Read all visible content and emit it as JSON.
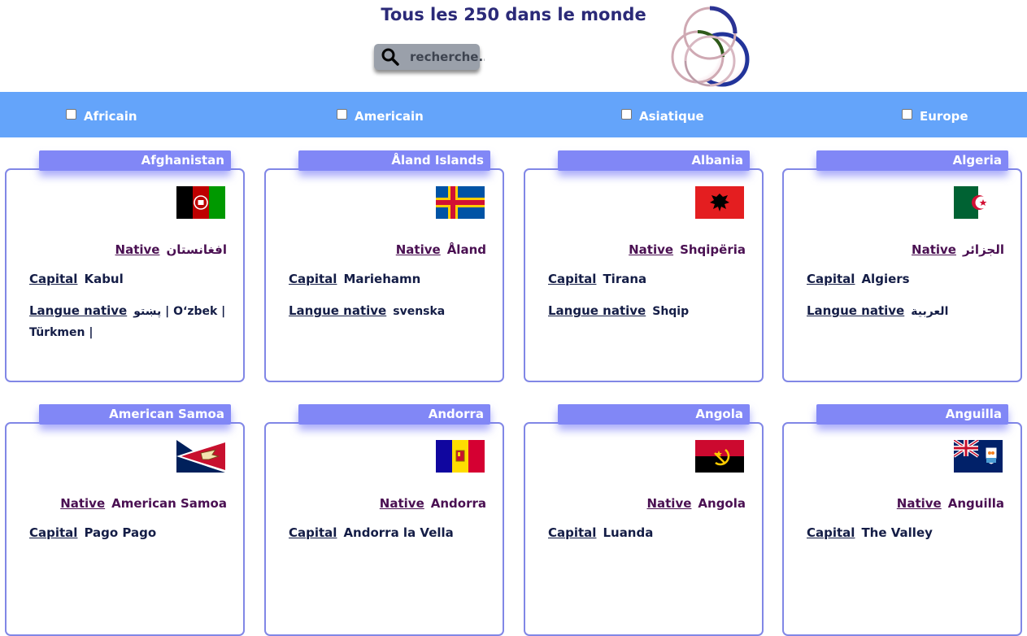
{
  "header": {
    "title": "Tous les 250 dans le monde",
    "search_placeholder": "recherche..",
    "icons": {
      "search": "search-icon",
      "logo": "interlocking-rings-logo"
    }
  },
  "colors": {
    "title": "#2b2a78",
    "filter_bar": "#64a4fa",
    "card_header": "#8187f6",
    "native_text": "#4a1052",
    "body_text": "#141d46"
  },
  "filters": [
    {
      "label": "Africain",
      "checked": false
    },
    {
      "label": "Americain",
      "checked": false
    },
    {
      "label": "Asiatique",
      "checked": false
    },
    {
      "label": "Europe",
      "checked": false
    }
  ],
  "labels": {
    "native": "Native",
    "capital": "Capital",
    "language": "Langue native"
  },
  "countries": [
    {
      "name": "Afghanistan",
      "flag": "afghanistan-flag-icon",
      "native": "افغانستان",
      "capital": "Kabul",
      "languages": "پښتو | Oʻzbek | Türkmen |"
    },
    {
      "name": "Åland Islands",
      "flag": "aland-flag-icon",
      "native": "Åland",
      "capital": "Mariehamn",
      "languages": "svenska"
    },
    {
      "name": "Albania",
      "flag": "albania-flag-icon",
      "native": "Shqipëria",
      "capital": "Tirana",
      "languages": "Shqip"
    },
    {
      "name": "Algeria",
      "flag": "algeria-flag-icon",
      "native": "الجزائر",
      "capital": "Algiers",
      "languages": "العربية"
    },
    {
      "name": "American Samoa",
      "flag": "american-samoa-flag-icon",
      "native": "American Samoa",
      "capital": "Pago Pago",
      "languages": ""
    },
    {
      "name": "Andorra",
      "flag": "andorra-flag-icon",
      "native": "Andorra",
      "capital": "Andorra la Vella",
      "languages": ""
    },
    {
      "name": "Angola",
      "flag": "angola-flag-icon",
      "native": "Angola",
      "capital": "Luanda",
      "languages": ""
    },
    {
      "name": "Anguilla",
      "flag": "anguilla-flag-icon",
      "native": "Anguilla",
      "capital": "The Valley",
      "languages": ""
    }
  ]
}
